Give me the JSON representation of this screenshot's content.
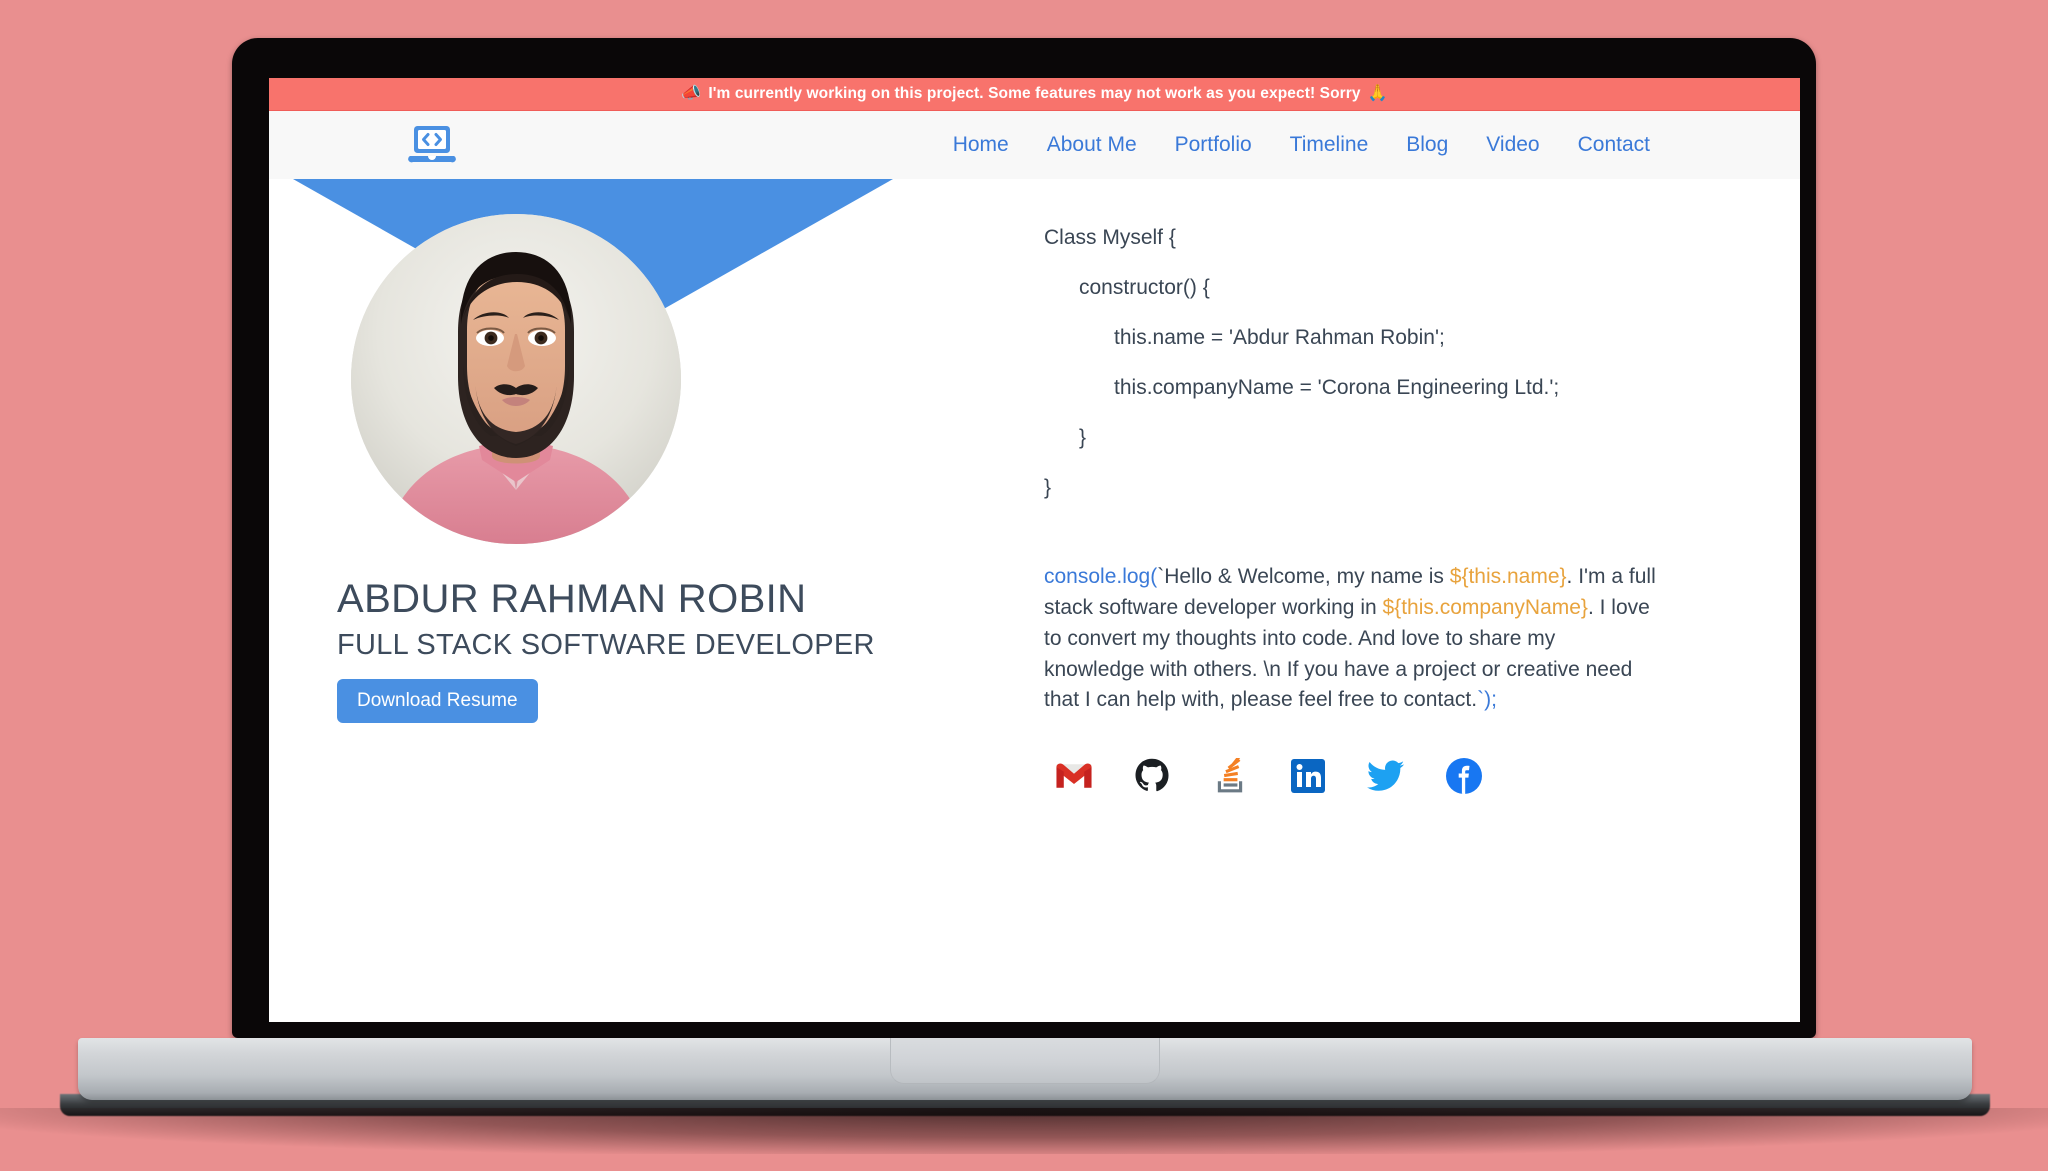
{
  "announcement": {
    "icon": "megaphone-emoji",
    "emoji": "📣",
    "text": "I'm currently working on this project. Some features may not work as you expect! Sorry",
    "end_emoji": "🙏",
    "background": "#f8736c",
    "text_color": "#ffffff"
  },
  "navbar": {
    "logo_icon": "laptop-code-icon",
    "background": "#f8f8f8",
    "link_color": "#3a79d8",
    "links": [
      {
        "label": "Home"
      },
      {
        "label": "About Me"
      },
      {
        "label": "Portfolio"
      },
      {
        "label": "Timeline"
      },
      {
        "label": "Blog"
      },
      {
        "label": "Video"
      },
      {
        "label": "Contact"
      }
    ]
  },
  "hero": {
    "triangle_color": "#4a90e2",
    "name": "ABDUR RAHMAN ROBIN",
    "role": "FULL STACK SOFTWARE DEVELOPER",
    "resume_button": "Download Resume",
    "resume_button_color": "#4a90e2",
    "avatar_alt": "Profile photo of Abdur Rahman Robin"
  },
  "code": {
    "lines": [
      "Class Myself {",
      "      constructor() {",
      "            this.name = 'Abdur Rahman Robin';",
      "            this.companyName = 'Corona Engineering Ltd.';",
      "      }",
      "}"
    ]
  },
  "console": {
    "fn": "console.log(",
    "open_tick": "`",
    "text1": "Hello & Welcome, my name is ",
    "var1": "${this.name}",
    "text2": ". I'm a full stack software developer working in ",
    "var2": "${this.companyName}",
    "text3": ". I love to convert my thoughts into code. And love to share my knowledge with others. \\n If you have a project or creative need that I can help with, please feel free to contact.",
    "close_tick": "`",
    "tail": ");",
    "fn_color": "#3a79d8",
    "var_color": "#e8a33d"
  },
  "social": [
    {
      "name": "gmail",
      "label": "Gmail",
      "color": "#d93025"
    },
    {
      "name": "github",
      "label": "GitHub",
      "color": "#1b1f23"
    },
    {
      "name": "stackoverflow",
      "label": "Stack Overflow",
      "color": "#f48024"
    },
    {
      "name": "linkedin",
      "label": "LinkedIn",
      "color": "#0a66c2"
    },
    {
      "name": "twitter",
      "label": "Twitter",
      "color": "#1da1f2"
    },
    {
      "name": "facebook",
      "label": "Facebook",
      "color": "#1877f2"
    }
  ],
  "page": {
    "background": "#e98f8f",
    "device": "laptop-mockup"
  }
}
